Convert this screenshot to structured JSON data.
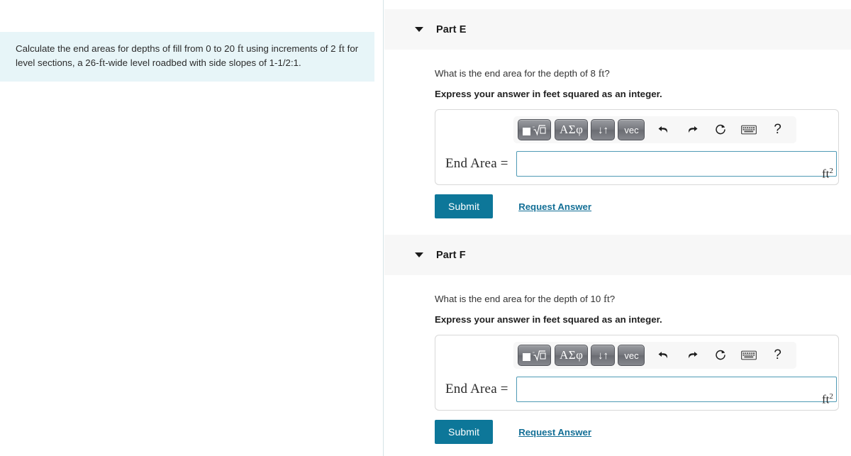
{
  "problem": {
    "text_before_1": "Calculate the end areas for depths of fill from 0 to 20 ",
    "unit_1": "ft",
    "text_mid_1": " using increments of",
    "text_before_2": "2 ",
    "unit_2": "ft",
    "text_mid_2": " for level sections, a 26-",
    "unit_3": "ft",
    "text_end": "-wide level roadbed with side slopes of 1-1/2:1.",
    "full_text": "Calculate the end areas for depths of fill from 0 to 20 ft using increments of 2 ft for level sections, a 26-ft-wide level roadbed with side slopes of 1-1/2:1."
  },
  "toolbar": {
    "template_label": "template-radical",
    "greek_label": "ΑΣφ",
    "arrows_label": "↓↑",
    "vec_label": "vec",
    "undo_label": "↰",
    "redo_label": "↱",
    "reset_label": "⟳",
    "keyboard_label": "keyboard",
    "help_label": "?"
  },
  "parts": [
    {
      "id": "part-e",
      "title": "Part E",
      "question": "What is the end area for the depth of 8 ft?",
      "question_before": "What is the end area for the depth of 8 ",
      "question_unit": "ft",
      "question_after": "?",
      "instruction": "Express your answer in feet squared as an integer.",
      "answer_label": "End Area =",
      "answer_value": "",
      "answer_placeholder": "",
      "unit": "ft",
      "unit_exponent": "2",
      "submit_label": "Submit",
      "request_label": "Request Answer"
    },
    {
      "id": "part-f",
      "title": "Part F",
      "question": "What is the end area for the depth of 10 ft?",
      "question_before": "What is the end area for the depth of 10 ",
      "question_unit": "ft",
      "question_after": "?",
      "instruction": "Express your answer in feet squared as an integer.",
      "answer_label": "End Area =",
      "answer_value": "",
      "answer_placeholder": "",
      "unit": "ft",
      "unit_exponent": "2",
      "submit_label": "Submit",
      "request_label": "Request Answer"
    }
  ],
  "colors": {
    "problem_background": "#e7f5f8",
    "header_background": "#f7f7f7",
    "submit_button": "#0d7799",
    "link": "#136f96",
    "input_border": "#4f9ab5"
  }
}
